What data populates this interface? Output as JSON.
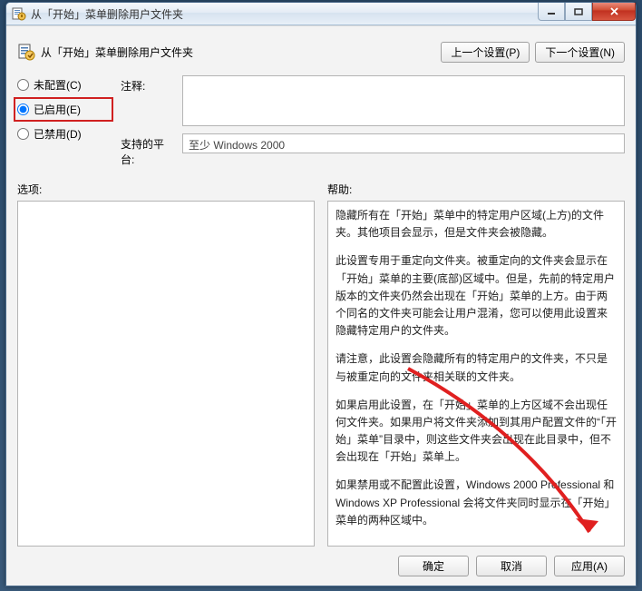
{
  "titlebar": {
    "title": "从「开始」菜单删除用户文件夹"
  },
  "header": {
    "title": "从「开始」菜单删除用户文件夹",
    "prev_label": "上一个设置(P)",
    "next_label": "下一个设置(N)"
  },
  "radios": {
    "not_configured": "未配置(C)",
    "enabled": "已启用(E)",
    "disabled": "已禁用(D)"
  },
  "form": {
    "comment_label": "注释:",
    "platform_label": "支持的平台:",
    "platform_value": "至少 Windows 2000"
  },
  "captions": {
    "options": "选项:",
    "help": "帮助:"
  },
  "help": {
    "p1": "隐藏所有在「开始」菜单中的特定用户区域(上方)的文件夹。其他项目会显示，但是文件夹会被隐藏。",
    "p2": "此设置专用于重定向文件夹。被重定向的文件夹会显示在「开始」菜单的主要(底部)区域中。但是，先前的特定用户版本的文件夹仍然会出现在「开始」菜单的上方。由于两个同名的文件夹可能会让用户混淆，您可以使用此设置来隐藏特定用户的文件夹。",
    "p3": "请注意，此设置会隐藏所有的特定用户的文件夹，不只是与被重定向的文件夹相关联的文件夹。",
    "p4": "如果启用此设置，在「开始」菜单的上方区域不会出现任何文件夹。如果用户将文件夹添加到其用户配置文件的“「开始」菜单”目录中，则这些文件夹会出现在此目录中，但不会出现在「开始」菜单上。",
    "p5": "如果禁用或不配置此设置，Windows 2000 Professional 和 Windows XP Professional 会将文件夹同时显示在「开始」菜单的两种区域中。"
  },
  "footer": {
    "ok": "确定",
    "cancel": "取消",
    "apply": "应用(A)"
  }
}
